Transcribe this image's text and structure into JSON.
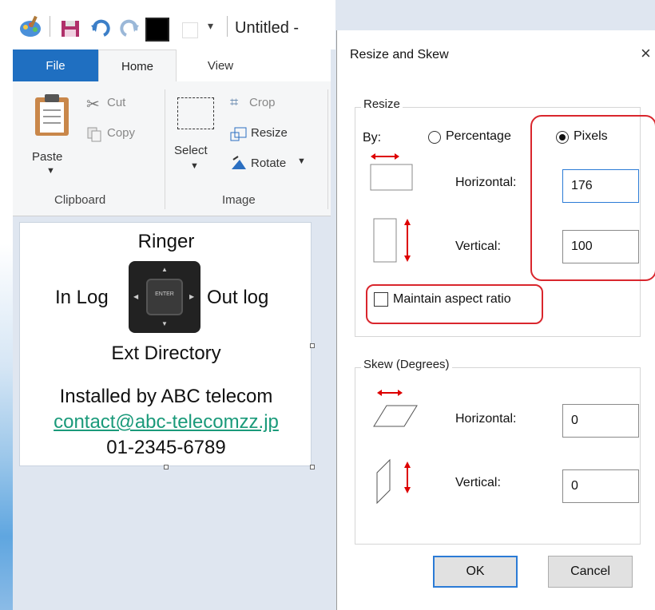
{
  "window": {
    "title": "Untitled -"
  },
  "tabs": {
    "file": "File",
    "home": "Home",
    "view": "View"
  },
  "clipboard": {
    "paste": "Paste",
    "cut": "Cut",
    "copy": "Copy",
    "group_label": "Clipboard"
  },
  "image": {
    "select": "Select",
    "crop": "Crop",
    "resize": "Resize",
    "rotate": "Rotate",
    "group_label": "Image"
  },
  "canvas": {
    "ringer": "Ringer",
    "in_log": "In Log",
    "out_log": "Out log",
    "ext_directory": "Ext Directory",
    "installed_by": "Installed by ABC telecom",
    "email": "contact@abc-telecomzz.jp",
    "phone": "01-2345-6789",
    "remote_center": "ENTER"
  },
  "dialog": {
    "title": "Resize and Skew",
    "close": "×",
    "resize": {
      "legend": "Resize",
      "by_label": "By:",
      "percentage_label": "Percentage",
      "pixels_label": "Pixels",
      "selected": "Pixels",
      "horizontal_label": "Horizontal:",
      "horizontal_value": "176",
      "vertical_label": "Vertical:",
      "vertical_value": "100",
      "maintain_aspect_label": "Maintain aspect ratio",
      "maintain_aspect_checked": false
    },
    "skew": {
      "legend": "Skew (Degrees)",
      "horizontal_label": "Horizontal:",
      "horizontal_value": "0",
      "vertical_label": "Vertical:",
      "vertical_value": "0"
    },
    "ok": "OK",
    "cancel": "Cancel"
  },
  "colors": {
    "file_tab": "#1f6fc1",
    "highlight": "#d9262d",
    "link": "#1a9a7a",
    "accent": "#2b7bd6"
  }
}
